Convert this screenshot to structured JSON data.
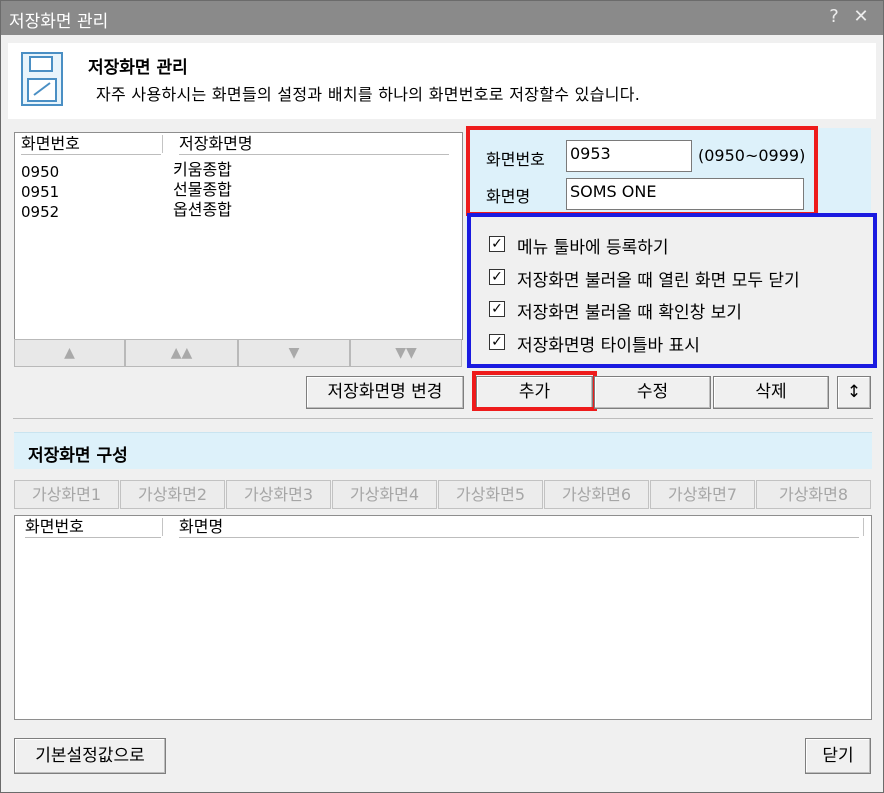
{
  "window": {
    "title": "저장화면 관리",
    "help": "?",
    "close": "✕"
  },
  "header": {
    "title": "저장화면 관리",
    "description": "자주 사용하시는 화면들의 설정과 배치를 하나의 화면번호로 저장할수 있습니다.",
    "icon": "save-disk-icon"
  },
  "saved_list": {
    "columns": [
      "화면번호",
      "저장화면명"
    ],
    "rows": [
      {
        "number": "0950",
        "name": "키움종합"
      },
      {
        "number": "0951",
        "name": "선물종합"
      },
      {
        "number": "0952",
        "name": "옵션종합"
      }
    ],
    "scroll_buttons": [
      "▲",
      "▲▲",
      "▼",
      "▼▼"
    ]
  },
  "form": {
    "screen_number_label": "화면번호",
    "screen_number_value": "0953",
    "screen_number_range": "(0950~0999)",
    "screen_name_label": "화면명",
    "screen_name_value": "SOMS ONE"
  },
  "options": [
    {
      "label": "메뉴 툴바에 등록하기",
      "checked": true
    },
    {
      "label": "저장화면 불러올 때 열린 화면 모두 닫기",
      "checked": true
    },
    {
      "label": "저장화면 불러올 때 확인창 보기",
      "checked": true
    },
    {
      "label": "저장화면명 타이틀바 표시",
      "checked": true
    }
  ],
  "actions": {
    "rename": "저장화면명 변경",
    "add": "추가",
    "edit": "수정",
    "delete": "삭제",
    "sort": "↕"
  },
  "config": {
    "title": "저장화면 구성",
    "virtual_tabs": [
      "가상화면1",
      "가상화면2",
      "가상화면3",
      "가상화면4",
      "가상화면5",
      "가상화면6",
      "가상화면7",
      "가상화면8"
    ],
    "columns": [
      "화면번호",
      "화면명"
    ]
  },
  "footer": {
    "reset": "기본설정값으로",
    "close": "닫기"
  },
  "colors": {
    "titlebar": "#8a8a8a",
    "panel_blue": "#ddf1fa",
    "highlight_red": "#ee1b1b",
    "highlight_blue": "#1a1ae0"
  }
}
